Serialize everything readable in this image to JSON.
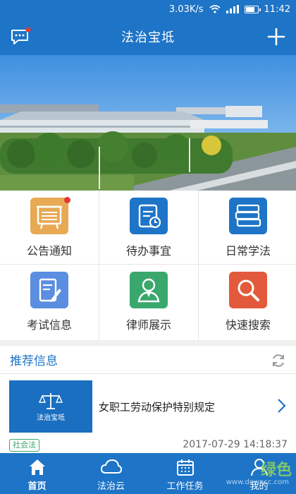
{
  "status_bar": {
    "speed": "3.03K/s",
    "time": "11:42"
  },
  "header": {
    "title": "法治宝坻"
  },
  "grid": [
    {
      "label": "公告通知",
      "icon": "bulletin-board-icon",
      "color": "#e8a954",
      "badge": true
    },
    {
      "label": "待办事宜",
      "icon": "todo-document-clock-icon",
      "color": "#1e74c6",
      "badge": false
    },
    {
      "label": "日常学法",
      "icon": "book-stack-icon",
      "color": "#1e74c6",
      "badge": false
    },
    {
      "label": "考试信息",
      "icon": "exam-pen-icon",
      "color": "#5b8de0",
      "badge": false
    },
    {
      "label": "律师展示",
      "icon": "lawyer-icon",
      "color": "#3aa76d",
      "badge": false
    },
    {
      "label": "快速搜索",
      "icon": "search-icon",
      "color": "#e25a3b",
      "badge": false
    }
  ],
  "recommend": {
    "title": "推荐信息"
  },
  "news": [
    {
      "thumb_text": "法治宝坻",
      "title": "女职工劳动保护特别规定",
      "tag": "社会法",
      "time": "2017-07-29 14:18:37"
    }
  ],
  "tabbar": [
    {
      "label": "首页",
      "icon": "home-icon",
      "active": true
    },
    {
      "label": "法治云",
      "icon": "cloud-icon",
      "active": false
    },
    {
      "label": "工作任务",
      "icon": "calendar-icon",
      "active": false
    },
    {
      "label": "我的",
      "icon": "user-icon",
      "active": false
    }
  ],
  "watermark": {
    "brand": "绿色",
    "site": "www.downcc.com"
  }
}
